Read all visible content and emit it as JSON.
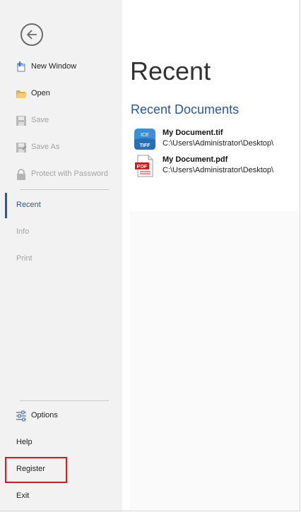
{
  "sidebar": {
    "back_icon": "back-arrow-icon",
    "items": [
      {
        "label": "New Window",
        "icon": "new-window-icon"
      },
      {
        "label": "Open",
        "icon": "folder-open-icon"
      },
      {
        "label": "Save",
        "icon": "save-icon"
      },
      {
        "label": "Save As",
        "icon": "save-as-icon"
      },
      {
        "label": "Protect with Password",
        "icon": "lock-icon"
      },
      {
        "label": "Recent"
      },
      {
        "label": "Info"
      },
      {
        "label": "Print"
      },
      {
        "label": "Options",
        "icon": "options-icon"
      },
      {
        "label": "Help"
      },
      {
        "label": "Register"
      },
      {
        "label": "Exit"
      }
    ]
  },
  "main": {
    "title": "Recent",
    "section_title": "Recent Documents",
    "documents": [
      {
        "name": "My Document.tif",
        "path": "C:\\Users\\Administrator\\Desktop\\",
        "icon_text_top": "ICE",
        "icon_text_bottom": "TIFF",
        "icon": "tiff-file-icon"
      },
      {
        "name": "My Document.pdf",
        "path": "C:\\Users\\Administrator\\Desktop\\",
        "icon_text": "PDF",
        "icon": "pdf-file-icon"
      }
    ]
  },
  "colors": {
    "accent": "#2b579a",
    "highlight": "#d91a1a",
    "sidebar_bg": "#f2f2f2",
    "disabled_text": "#a3a3a3"
  }
}
